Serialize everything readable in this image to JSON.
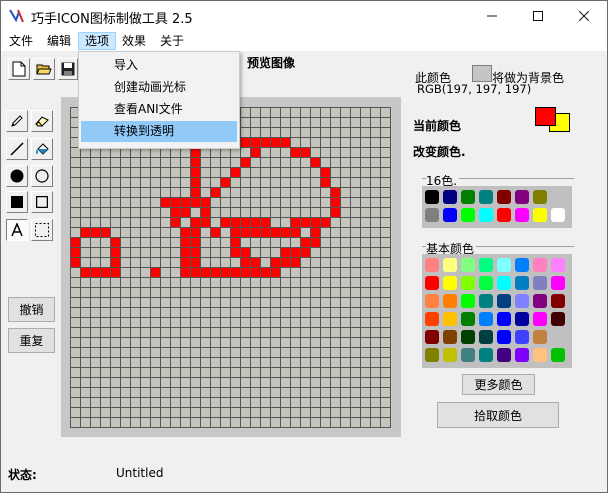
{
  "window": {
    "title": "巧手ICON图标制做工具 2.5"
  },
  "menu": [
    "文件",
    "编辑",
    "选项",
    "效果",
    "关于"
  ],
  "dropdown": [
    "导入",
    "创建动画光标",
    "查看ANI文件",
    "转换到透明"
  ],
  "toolbar": {
    "preview_label": "预览图像"
  },
  "tools": [
    "pencil-icon",
    "eraser-icon",
    "line-icon",
    "fill-icon",
    "filled-circle-icon",
    "circle-icon",
    "filled-rect-icon",
    "rect-icon",
    "text-icon",
    "select-icon"
  ],
  "buttons": {
    "undo": "撤销",
    "redo": "重复",
    "more_colors": "更多颜色",
    "pick_color": "拾取颜色"
  },
  "color_info": {
    "this_color": "此颜色",
    "set_background": "将做为背景色",
    "rgb": "RGB(197, 197, 197)",
    "current_color": "当前颜色",
    "change_color": "改变颜色.",
    "palette16_label": "16色.",
    "basic_label": "基本颜色",
    "foreground": "#ff0000",
    "background": "#ffff00",
    "hover_swatch": "#c5c5c5"
  },
  "palette16": [
    "#000000",
    "#000080",
    "#008000",
    "#008080",
    "#800000",
    "#800080",
    "#808000",
    "#c0c0c0",
    "#808080",
    "#0000ff",
    "#00ff00",
    "#00ffff",
    "#ff0000",
    "#ff00ff",
    "#ffff00",
    "#ffffff"
  ],
  "basic_colors": [
    "#ff8080",
    "#ffff80",
    "#80ff80",
    "#00ff80",
    "#80ffff",
    "#0080ff",
    "#ff80c0",
    "#ff80ff",
    "#ff0000",
    "#ffff00",
    "#80ff00",
    "#00ff40",
    "#00ffff",
    "#0080c0",
    "#8080c0",
    "#ff00ff",
    "#804040",
    "#ff8040",
    "#00ff00",
    "#008080",
    "#004080",
    "#8080ff",
    "#800040",
    "#ff0080",
    "#800000",
    "#ff8000",
    "#008000",
    "#008040",
    "#0000ff",
    "#0000a0",
    "#800080",
    "#8000ff",
    "#400000",
    "#804000",
    "#004000",
    "#004040",
    "#000080",
    "#000040",
    "#400040",
    "#400080",
    "#000000",
    "#808000",
    "#808040",
    "#808080",
    "#408080",
    "#c0c0c0",
    "#400040",
    "#ffffff"
  ],
  "basic_colors_visible": [
    "#ff8080",
    "#ffff80",
    "#80ff80",
    "#00ff80",
    "#80ffff",
    "#0080ff",
    "#ff80c0",
    "#ff80ff",
    "#ff0000",
    "#ffff00",
    "#80ff00",
    "#00ff40",
    "#00ffff",
    "#0080c0",
    "#8080c0",
    "#ff00ff",
    "#ff8040",
    "#ff8000",
    "#00ff00",
    "#008080",
    "#004080",
    "#8080ff",
    "#800080",
    "#800000",
    "#ff4000",
    "#ffc000",
    "#008000",
    "#0080ff",
    "#0000ff",
    "#0000a0",
    "#ff00ff",
    "#400000",
    "#800000",
    "#804000",
    "#004000",
    "#004040",
    "#0000ff",
    "#4040ff",
    "#c08040",
    "#c0c0c0",
    "#808000",
    "#c0c000",
    "#408080",
    "#008080",
    "#400080",
    "#8000ff",
    "#ffc080",
    "#00c000"
  ],
  "canvas": {
    "grid_size": 32,
    "bg": "#c5c5bd",
    "line": "#555555",
    "pixel_color": "#ff0000",
    "pixels": [
      [
        12,
        3
      ],
      [
        13,
        3
      ],
      [
        14,
        3
      ],
      [
        15,
        3
      ],
      [
        16,
        3
      ],
      [
        17,
        3
      ],
      [
        18,
        3
      ],
      [
        19,
        3
      ],
      [
        20,
        3
      ],
      [
        21,
        3
      ],
      [
        12,
        4
      ],
      [
        18,
        4
      ],
      [
        22,
        4
      ],
      [
        23,
        4
      ],
      [
        12,
        5
      ],
      [
        17,
        5
      ],
      [
        24,
        5
      ],
      [
        12,
        6
      ],
      [
        16,
        6
      ],
      [
        25,
        6
      ],
      [
        12,
        7
      ],
      [
        15,
        7
      ],
      [
        25,
        7
      ],
      [
        12,
        8
      ],
      [
        14,
        8
      ],
      [
        26,
        8
      ],
      [
        9,
        9
      ],
      [
        10,
        9
      ],
      [
        11,
        9
      ],
      [
        12,
        9
      ],
      [
        13,
        9
      ],
      [
        26,
        9
      ],
      [
        10,
        10
      ],
      [
        11,
        10
      ],
      [
        13,
        10
      ],
      [
        26,
        10
      ],
      [
        10,
        11
      ],
      [
        12,
        11
      ],
      [
        13,
        11
      ],
      [
        15,
        11
      ],
      [
        16,
        11
      ],
      [
        17,
        11
      ],
      [
        18,
        11
      ],
      [
        19,
        11
      ],
      [
        22,
        11
      ],
      [
        23,
        11
      ],
      [
        24,
        11
      ],
      [
        25,
        11
      ],
      [
        1,
        12
      ],
      [
        2,
        12
      ],
      [
        3,
        12
      ],
      [
        11,
        12
      ],
      [
        12,
        12
      ],
      [
        14,
        12
      ],
      [
        16,
        12
      ],
      [
        17,
        12
      ],
      [
        18,
        12
      ],
      [
        19,
        12
      ],
      [
        20,
        12
      ],
      [
        21,
        12
      ],
      [
        22,
        12
      ],
      [
        24,
        12
      ],
      [
        0,
        13
      ],
      [
        4,
        13
      ],
      [
        11,
        13
      ],
      [
        12,
        13
      ],
      [
        16,
        13
      ],
      [
        23,
        13
      ],
      [
        24,
        13
      ],
      [
        0,
        14
      ],
      [
        4,
        14
      ],
      [
        11,
        14
      ],
      [
        12,
        14
      ],
      [
        16,
        14
      ],
      [
        17,
        14
      ],
      [
        21,
        14
      ],
      [
        22,
        14
      ],
      [
        23,
        14
      ],
      [
        0,
        15
      ],
      [
        4,
        15
      ],
      [
        11,
        15
      ],
      [
        12,
        15
      ],
      [
        17,
        15
      ],
      [
        18,
        15
      ],
      [
        20,
        15
      ],
      [
        21,
        15
      ],
      [
        22,
        15
      ],
      [
        1,
        16
      ],
      [
        2,
        16
      ],
      [
        3,
        16
      ],
      [
        4,
        16
      ],
      [
        8,
        16
      ],
      [
        11,
        16
      ],
      [
        12,
        16
      ],
      [
        13,
        16
      ],
      [
        14,
        16
      ],
      [
        15,
        16
      ],
      [
        16,
        16
      ],
      [
        17,
        16
      ],
      [
        18,
        16
      ],
      [
        19,
        16
      ],
      [
        20,
        16
      ]
    ]
  },
  "status": {
    "label": "状态:",
    "value": "Untitled"
  }
}
